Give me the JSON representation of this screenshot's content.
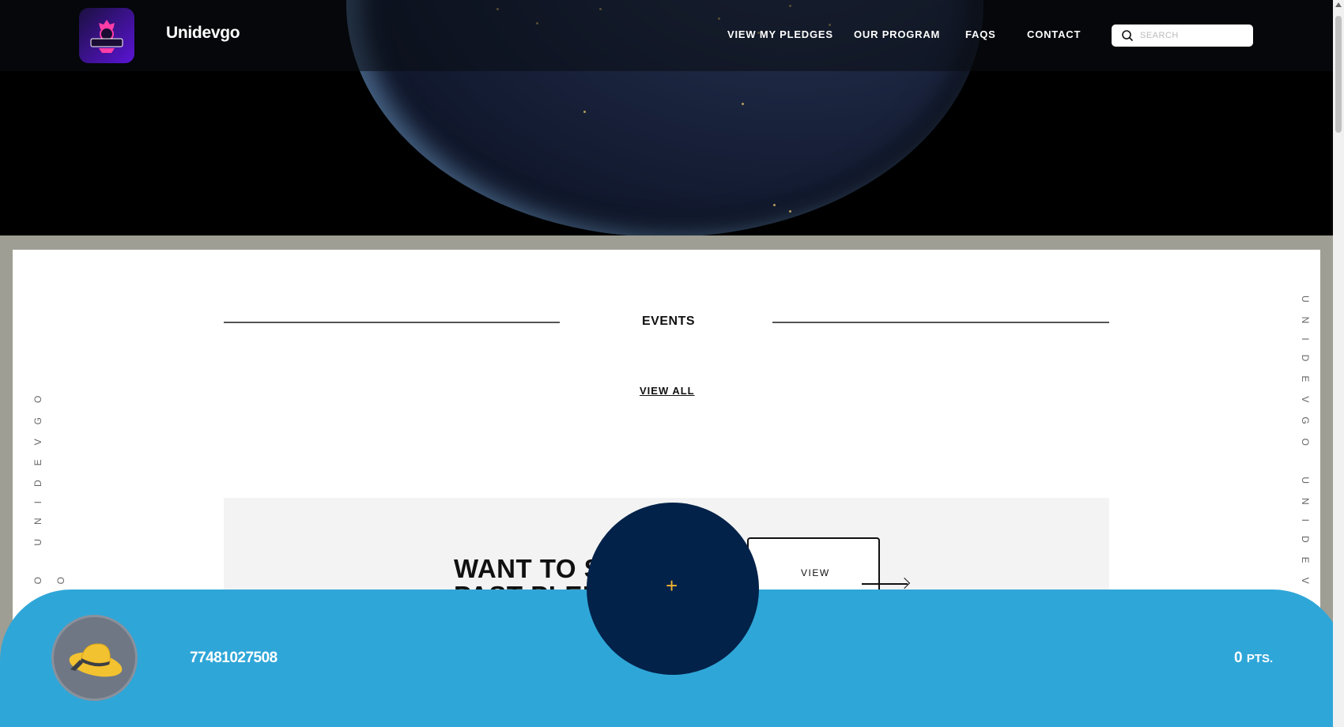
{
  "header": {
    "logo_alt": "GAMING",
    "brand": "Unidevgo",
    "nav": [
      "VIEW MY PLEDGES",
      "OUR PROGRAM",
      "FAQS",
      "CONTACT"
    ],
    "search_placeholder": "SEARCH"
  },
  "side_text": {
    "left": "UNIDEVGO UNIDEVGO UNIDEVGO",
    "right": "UNIDEVGO UNIDEVGO"
  },
  "events": {
    "title": "EVENTS",
    "view_all": "VIEW ALL"
  },
  "promo": {
    "title_line1": "WANT TO S",
    "title_line2": "PAST PLEDG",
    "view_label": "VIEW"
  },
  "footer_bar": {
    "user_id": "77481027508",
    "points_value": "0",
    "points_unit": "PTS.",
    "fab_symbol": "+"
  },
  "colors": {
    "hero_bg": "#000000",
    "bottom_bar": "#2fa6d8",
    "fab": "#02224a",
    "fab_plus": "#f2b32e",
    "logo_gradient_end": "#5b14d6"
  },
  "icons": [
    "gaming-logo-icon",
    "search-icon",
    "hat-avatar-icon",
    "arrow-right-icon"
  ]
}
